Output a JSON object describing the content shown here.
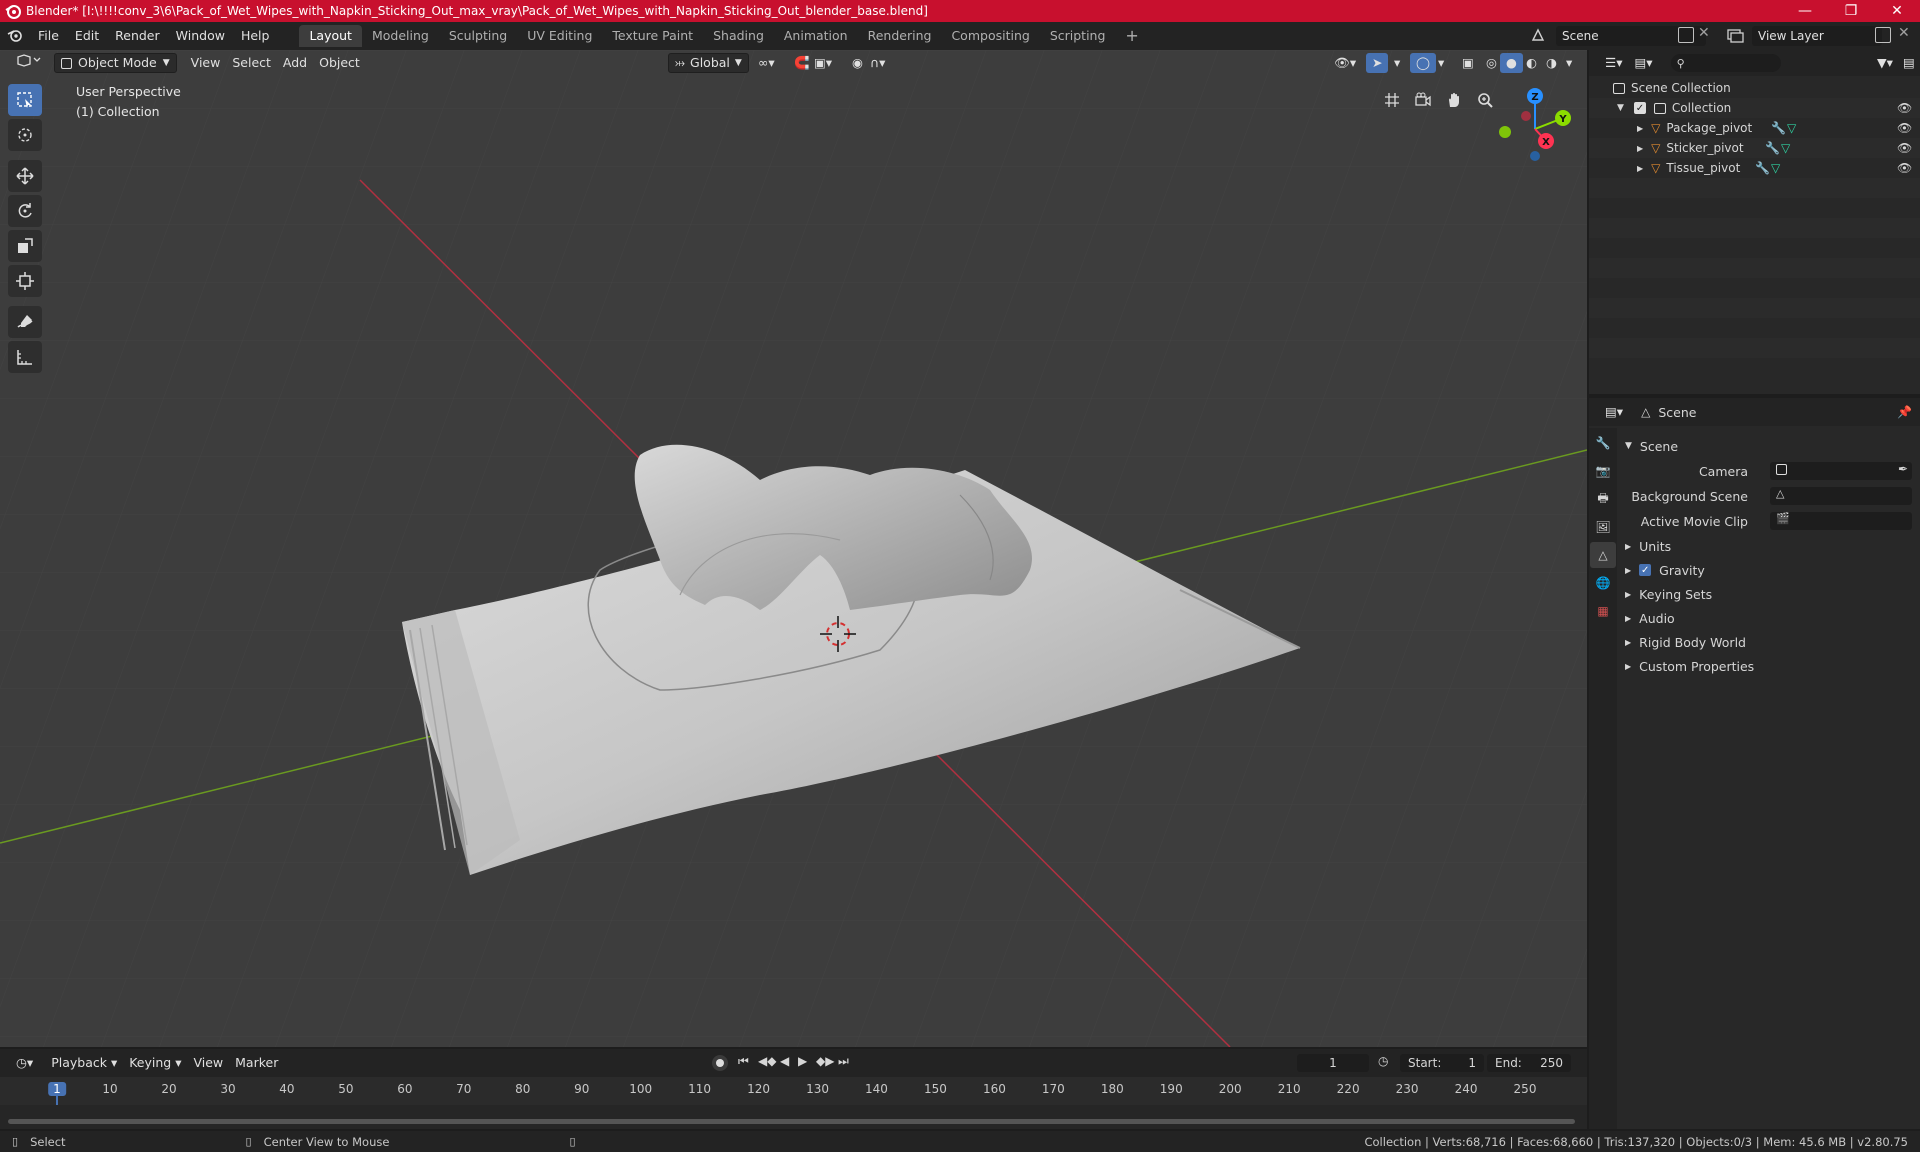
{
  "window": {
    "title": "Blender* [I:\\!!!!conv_3\\6\\Pack_of_Wet_Wipes_with_Napkin_Sticking_Out_max_vray\\Pack_of_Wet_Wipes_with_Napkin_Sticking_Out_blender_base.blend]"
  },
  "menu": [
    "File",
    "Edit",
    "Render",
    "Window",
    "Help"
  ],
  "workspaces": [
    "Layout",
    "Modeling",
    "Sculpting",
    "UV Editing",
    "Texture Paint",
    "Shading",
    "Animation",
    "Rendering",
    "Compositing",
    "Scripting"
  ],
  "scene_selector": "Scene",
  "view_layer_selector": "View Layer",
  "viewport": {
    "mode": "Object Mode",
    "menus": [
      "View",
      "Select",
      "Add",
      "Object"
    ],
    "transform_orientation": "Global",
    "perspective_label": "User Perspective",
    "collection_label": "(1) Collection"
  },
  "gizmo": {
    "x": "X",
    "y": "Y",
    "z": "Z"
  },
  "outliner": {
    "root": "Scene Collection",
    "collection": "Collection",
    "objects": [
      "Package_pivot",
      "Sticker_pivot",
      "Tissue_pivot"
    ]
  },
  "properties": {
    "header": "Scene",
    "panel": "Scene",
    "fields": [
      "Camera",
      "Background Scene",
      "Active Movie Clip"
    ],
    "subpanels": [
      "Units",
      "Gravity",
      "Keying Sets",
      "Audio",
      "Rigid Body World",
      "Custom Properties"
    ]
  },
  "timeline": {
    "menus": [
      "Playback",
      "Keying",
      "View",
      "Marker"
    ],
    "current_frame": "1",
    "start_label": "Start:",
    "start": "1",
    "end_label": "End:",
    "end": "250",
    "ticks": [
      "1",
      "10",
      "20",
      "30",
      "40",
      "50",
      "60",
      "70",
      "80",
      "90",
      "100",
      "110",
      "120",
      "130",
      "140",
      "150",
      "160",
      "170",
      "180",
      "190",
      "200",
      "210",
      "220",
      "230",
      "240",
      "250"
    ]
  },
  "status": {
    "left": "Select",
    "middle": "Center View to Mouse",
    "right": "Collection | Verts:68,716 | Faces:68,660 | Tris:137,320 | Objects:0/3 | Mem: 45.6 MB | v2.80.75"
  },
  "colors": {
    "title_bg": "#c8102e",
    "accent": "#4772b3",
    "x_axis": "#ff3352",
    "y_axis": "#8bdc00",
    "z_axis": "#2890ff"
  }
}
